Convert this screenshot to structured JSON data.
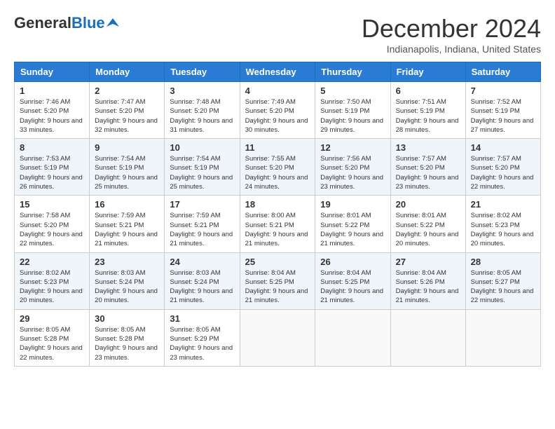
{
  "header": {
    "logo_general": "General",
    "logo_blue": "Blue",
    "month_title": "December 2024",
    "location": "Indianapolis, Indiana, United States"
  },
  "days_of_week": [
    "Sunday",
    "Monday",
    "Tuesday",
    "Wednesday",
    "Thursday",
    "Friday",
    "Saturday"
  ],
  "weeks": [
    [
      {
        "day": "1",
        "sunrise": "Sunrise: 7:46 AM",
        "sunset": "Sunset: 5:20 PM",
        "daylight": "Daylight: 9 hours and 33 minutes."
      },
      {
        "day": "2",
        "sunrise": "Sunrise: 7:47 AM",
        "sunset": "Sunset: 5:20 PM",
        "daylight": "Daylight: 9 hours and 32 minutes."
      },
      {
        "day": "3",
        "sunrise": "Sunrise: 7:48 AM",
        "sunset": "Sunset: 5:20 PM",
        "daylight": "Daylight: 9 hours and 31 minutes."
      },
      {
        "day": "4",
        "sunrise": "Sunrise: 7:49 AM",
        "sunset": "Sunset: 5:20 PM",
        "daylight": "Daylight: 9 hours and 30 minutes."
      },
      {
        "day": "5",
        "sunrise": "Sunrise: 7:50 AM",
        "sunset": "Sunset: 5:19 PM",
        "daylight": "Daylight: 9 hours and 29 minutes."
      },
      {
        "day": "6",
        "sunrise": "Sunrise: 7:51 AM",
        "sunset": "Sunset: 5:19 PM",
        "daylight": "Daylight: 9 hours and 28 minutes."
      },
      {
        "day": "7",
        "sunrise": "Sunrise: 7:52 AM",
        "sunset": "Sunset: 5:19 PM",
        "daylight": "Daylight: 9 hours and 27 minutes."
      }
    ],
    [
      {
        "day": "8",
        "sunrise": "Sunrise: 7:53 AM",
        "sunset": "Sunset: 5:19 PM",
        "daylight": "Daylight: 9 hours and 26 minutes."
      },
      {
        "day": "9",
        "sunrise": "Sunrise: 7:54 AM",
        "sunset": "Sunset: 5:19 PM",
        "daylight": "Daylight: 9 hours and 25 minutes."
      },
      {
        "day": "10",
        "sunrise": "Sunrise: 7:54 AM",
        "sunset": "Sunset: 5:19 PM",
        "daylight": "Daylight: 9 hours and 25 minutes."
      },
      {
        "day": "11",
        "sunrise": "Sunrise: 7:55 AM",
        "sunset": "Sunset: 5:20 PM",
        "daylight": "Daylight: 9 hours and 24 minutes."
      },
      {
        "day": "12",
        "sunrise": "Sunrise: 7:56 AM",
        "sunset": "Sunset: 5:20 PM",
        "daylight": "Daylight: 9 hours and 23 minutes."
      },
      {
        "day": "13",
        "sunrise": "Sunrise: 7:57 AM",
        "sunset": "Sunset: 5:20 PM",
        "daylight": "Daylight: 9 hours and 23 minutes."
      },
      {
        "day": "14",
        "sunrise": "Sunrise: 7:57 AM",
        "sunset": "Sunset: 5:20 PM",
        "daylight": "Daylight: 9 hours and 22 minutes."
      }
    ],
    [
      {
        "day": "15",
        "sunrise": "Sunrise: 7:58 AM",
        "sunset": "Sunset: 5:20 PM",
        "daylight": "Daylight: 9 hours and 22 minutes."
      },
      {
        "day": "16",
        "sunrise": "Sunrise: 7:59 AM",
        "sunset": "Sunset: 5:21 PM",
        "daylight": "Daylight: 9 hours and 21 minutes."
      },
      {
        "day": "17",
        "sunrise": "Sunrise: 7:59 AM",
        "sunset": "Sunset: 5:21 PM",
        "daylight": "Daylight: 9 hours and 21 minutes."
      },
      {
        "day": "18",
        "sunrise": "Sunrise: 8:00 AM",
        "sunset": "Sunset: 5:21 PM",
        "daylight": "Daylight: 9 hours and 21 minutes."
      },
      {
        "day": "19",
        "sunrise": "Sunrise: 8:01 AM",
        "sunset": "Sunset: 5:22 PM",
        "daylight": "Daylight: 9 hours and 21 minutes."
      },
      {
        "day": "20",
        "sunrise": "Sunrise: 8:01 AM",
        "sunset": "Sunset: 5:22 PM",
        "daylight": "Daylight: 9 hours and 20 minutes."
      },
      {
        "day": "21",
        "sunrise": "Sunrise: 8:02 AM",
        "sunset": "Sunset: 5:23 PM",
        "daylight": "Daylight: 9 hours and 20 minutes."
      }
    ],
    [
      {
        "day": "22",
        "sunrise": "Sunrise: 8:02 AM",
        "sunset": "Sunset: 5:23 PM",
        "daylight": "Daylight: 9 hours and 20 minutes."
      },
      {
        "day": "23",
        "sunrise": "Sunrise: 8:03 AM",
        "sunset": "Sunset: 5:24 PM",
        "daylight": "Daylight: 9 hours and 20 minutes."
      },
      {
        "day": "24",
        "sunrise": "Sunrise: 8:03 AM",
        "sunset": "Sunset: 5:24 PM",
        "daylight": "Daylight: 9 hours and 21 minutes."
      },
      {
        "day": "25",
        "sunrise": "Sunrise: 8:04 AM",
        "sunset": "Sunset: 5:25 PM",
        "daylight": "Daylight: 9 hours and 21 minutes."
      },
      {
        "day": "26",
        "sunrise": "Sunrise: 8:04 AM",
        "sunset": "Sunset: 5:25 PM",
        "daylight": "Daylight: 9 hours and 21 minutes."
      },
      {
        "day": "27",
        "sunrise": "Sunrise: 8:04 AM",
        "sunset": "Sunset: 5:26 PM",
        "daylight": "Daylight: 9 hours and 21 minutes."
      },
      {
        "day": "28",
        "sunrise": "Sunrise: 8:05 AM",
        "sunset": "Sunset: 5:27 PM",
        "daylight": "Daylight: 9 hours and 22 minutes."
      }
    ],
    [
      {
        "day": "29",
        "sunrise": "Sunrise: 8:05 AM",
        "sunset": "Sunset: 5:28 PM",
        "daylight": "Daylight: 9 hours and 22 minutes."
      },
      {
        "day": "30",
        "sunrise": "Sunrise: 8:05 AM",
        "sunset": "Sunset: 5:28 PM",
        "daylight": "Daylight: 9 hours and 23 minutes."
      },
      {
        "day": "31",
        "sunrise": "Sunrise: 8:05 AM",
        "sunset": "Sunset: 5:29 PM",
        "daylight": "Daylight: 9 hours and 23 minutes."
      },
      null,
      null,
      null,
      null
    ]
  ]
}
